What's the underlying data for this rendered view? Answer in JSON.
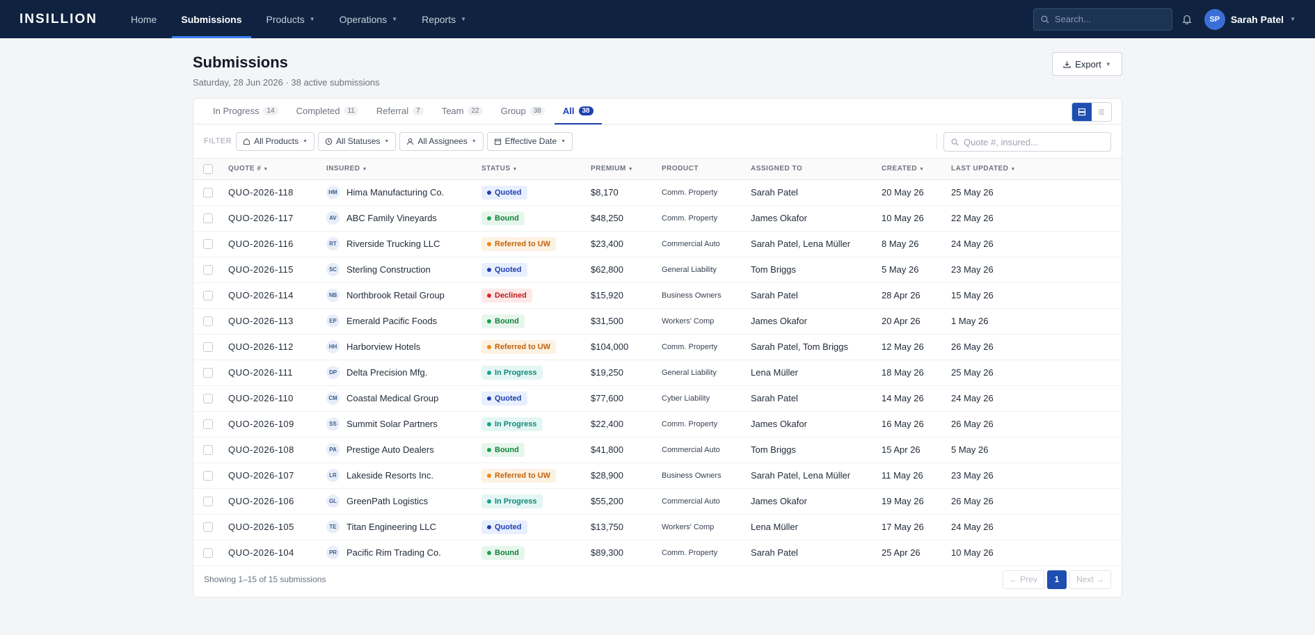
{
  "app": {
    "logo": "INSILLION"
  },
  "nav": [
    {
      "label": "Home",
      "dropdown": false,
      "active": false
    },
    {
      "label": "Submissions",
      "dropdown": false,
      "active": true
    },
    {
      "label": "Products",
      "dropdown": true,
      "active": false
    },
    {
      "label": "Operations",
      "dropdown": true,
      "active": false
    },
    {
      "label": "Reports",
      "dropdown": true,
      "active": false
    }
  ],
  "header": {
    "search_placeholder": "Search...",
    "user_initials": "SP",
    "user_name": "Sarah Patel"
  },
  "page": {
    "title": "Submissions",
    "subtitle": "Saturday, 28 Jun 2026 · 38 active submissions",
    "export_label": "Export"
  },
  "tabs": [
    {
      "label": "In Progress",
      "count": "14",
      "active": false
    },
    {
      "label": "Completed",
      "count": "11",
      "active": false
    },
    {
      "label": "Referral",
      "count": "7",
      "active": false
    },
    {
      "label": "Team",
      "count": "22",
      "active": false
    },
    {
      "label": "Group",
      "count": "38",
      "active": false
    },
    {
      "label": "All",
      "count": "38",
      "active": true
    }
  ],
  "filters": {
    "label": "FILTER",
    "products": "All Products",
    "statuses": "All Statuses",
    "assignees": "All Assignees",
    "date": "Effective Date",
    "search_placeholder": "Quote #, insured..."
  },
  "columns": {
    "quote": "Quote #",
    "insured": "Insured",
    "status": "Status",
    "premium": "Premium",
    "product": "Product",
    "assigned": "Assigned To",
    "created": "Created",
    "updated": "Last Updated"
  },
  "rows": [
    {
      "quote": "QUO-2026-118",
      "initials": "HM",
      "insured": "Hima Manufacturing Co.",
      "status": "Quoted",
      "status_type": "quoted",
      "premium": "$8,170",
      "product": "Comm. Property",
      "assigned": "Sarah Patel",
      "created": "20 May 26",
      "updated": "25 May 26"
    },
    {
      "quote": "QUO-2026-117",
      "initials": "AV",
      "insured": "ABC Family Vineyards",
      "status": "Bound",
      "status_type": "bound",
      "premium": "$48,250",
      "product": "Comm. Property",
      "assigned": "James Okafor",
      "created": "10 May 26",
      "updated": "22 May 26"
    },
    {
      "quote": "QUO-2026-116",
      "initials": "RT",
      "insured": "Riverside Trucking LLC",
      "status": "Referred to UW",
      "status_type": "referred",
      "premium": "$23,400",
      "product": "Commercial Auto",
      "assigned": "Sarah Patel, Lena Müller",
      "created": "8 May 26",
      "updated": "24 May 26"
    },
    {
      "quote": "QUO-2026-115",
      "initials": "SC",
      "insured": "Sterling Construction",
      "status": "Quoted",
      "status_type": "quoted",
      "premium": "$62,800",
      "product": "General Liability",
      "assigned": "Tom Briggs",
      "created": "5 May 26",
      "updated": "23 May 26"
    },
    {
      "quote": "QUO-2026-114",
      "initials": "NB",
      "insured": "Northbrook Retail Group",
      "status": "Declined",
      "status_type": "declined",
      "premium": "$15,920",
      "product": "Business Owners",
      "assigned": "Sarah Patel",
      "created": "28 Apr 26",
      "updated": "15 May 26"
    },
    {
      "quote": "QUO-2026-113",
      "initials": "EP",
      "insured": "Emerald Pacific Foods",
      "status": "Bound",
      "status_type": "bound",
      "premium": "$31,500",
      "product": "Workers' Comp",
      "assigned": "James Okafor",
      "created": "20 Apr 26",
      "updated": "1 May 26"
    },
    {
      "quote": "QUO-2026-112",
      "initials": "HH",
      "insured": "Harborview Hotels",
      "status": "Referred to UW",
      "status_type": "referred",
      "premium": "$104,000",
      "product": "Comm. Property",
      "assigned": "Sarah Patel, Tom Briggs",
      "created": "12 May 26",
      "updated": "26 May 26"
    },
    {
      "quote": "QUO-2026-111",
      "initials": "DP",
      "insured": "Delta Precision Mfg.",
      "status": "In Progress",
      "status_type": "progress",
      "premium": "$19,250",
      "product": "General Liability",
      "assigned": "Lena Müller",
      "created": "18 May 26",
      "updated": "25 May 26"
    },
    {
      "quote": "QUO-2026-110",
      "initials": "CM",
      "insured": "Coastal Medical Group",
      "status": "Quoted",
      "status_type": "quoted",
      "premium": "$77,600",
      "product": "Cyber Liability",
      "assigned": "Sarah Patel",
      "created": "14 May 26",
      "updated": "24 May 26"
    },
    {
      "quote": "QUO-2026-109",
      "initials": "SS",
      "insured": "Summit Solar Partners",
      "status": "In Progress",
      "status_type": "progress",
      "premium": "$22,400",
      "product": "Comm. Property",
      "assigned": "James Okafor",
      "created": "16 May 26",
      "updated": "26 May 26"
    },
    {
      "quote": "QUO-2026-108",
      "initials": "PA",
      "insured": "Prestige Auto Dealers",
      "status": "Bound",
      "status_type": "bound",
      "premium": "$41,800",
      "product": "Commercial Auto",
      "assigned": "Tom Briggs",
      "created": "15 Apr 26",
      "updated": "5 May 26"
    },
    {
      "quote": "QUO-2026-107",
      "initials": "LR",
      "insured": "Lakeside Resorts Inc.",
      "status": "Referred to UW",
      "status_type": "referred",
      "premium": "$28,900",
      "product": "Business Owners",
      "assigned": "Sarah Patel, Lena Müller",
      "created": "11 May 26",
      "updated": "23 May 26"
    },
    {
      "quote": "QUO-2026-106",
      "initials": "GL",
      "insured": "GreenPath Logistics",
      "status": "In Progress",
      "status_type": "progress",
      "premium": "$55,200",
      "product": "Commercial Auto",
      "assigned": "James Okafor",
      "created": "19 May 26",
      "updated": "26 May 26"
    },
    {
      "quote": "QUO-2026-105",
      "initials": "TE",
      "insured": "Titan Engineering LLC",
      "status": "Quoted",
      "status_type": "quoted",
      "premium": "$13,750",
      "product": "Workers' Comp",
      "assigned": "Lena Müller",
      "created": "17 May 26",
      "updated": "24 May 26"
    },
    {
      "quote": "QUO-2026-104",
      "initials": "PR",
      "insured": "Pacific Rim Trading Co.",
      "status": "Bound",
      "status_type": "bound",
      "premium": "$89,300",
      "product": "Comm. Property",
      "assigned": "Sarah Patel",
      "created": "25 Apr 26",
      "updated": "10 May 26"
    }
  ],
  "footer": {
    "showing": "Showing 1–15 of 15 submissions",
    "prev": "← Prev",
    "current_page": "1",
    "next": "Next →"
  },
  "colors": {
    "nav_bg": "#0f2340",
    "accent": "#1e40af",
    "quoted": "#1e40af",
    "bound": "#15803d",
    "referred": "#c2620c",
    "declined": "#b91c1c",
    "in_progress": "#0f8a78"
  }
}
